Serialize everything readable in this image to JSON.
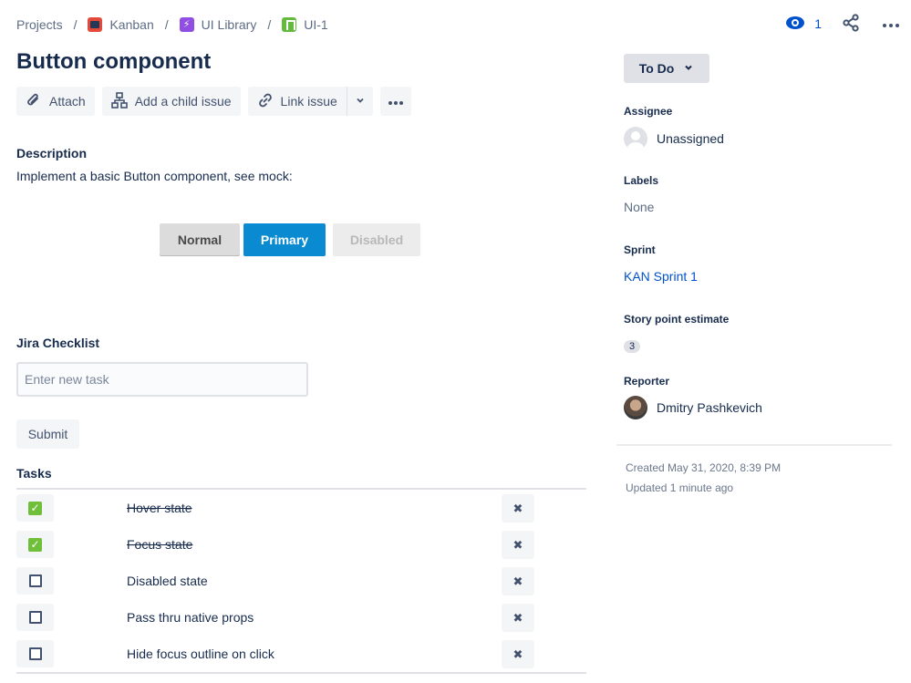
{
  "breadcrumb": {
    "projects": "Projects",
    "sep": "/",
    "kanban": "Kanban",
    "epic": "UI Library",
    "issue": "UI-1"
  },
  "header": {
    "watch_count": "1"
  },
  "issue": {
    "title": "Button component"
  },
  "actions": {
    "attach": "Attach",
    "add_child": "Add a child issue",
    "link_issue": "Link issue"
  },
  "description": {
    "heading": "Description",
    "text": "Implement a basic Button component, see mock:",
    "mock_buttons": {
      "normal": "Normal",
      "primary": "Primary",
      "disabled": "Disabled"
    }
  },
  "checklist": {
    "heading": "Jira Checklist",
    "placeholder": "Enter new task",
    "submit": "Submit",
    "tasks_heading": "Tasks",
    "tasks": [
      {
        "text": "Hover state",
        "done": true
      },
      {
        "text": "Focus state",
        "done": true
      },
      {
        "text": "Disabled state",
        "done": false
      },
      {
        "text": "Pass thru native props",
        "done": false
      },
      {
        "text": "Hide focus outline on click",
        "done": false
      }
    ],
    "delete_glyph": "✖"
  },
  "sidebar": {
    "status": "To Do",
    "assignee_label": "Assignee",
    "assignee": "Unassigned",
    "labels_label": "Labels",
    "labels": "None",
    "sprint_label": "Sprint",
    "sprint": "KAN Sprint 1",
    "story_points_label": "Story point estimate",
    "story_points": "3",
    "reporter_label": "Reporter",
    "reporter": "Dmitry Pashkevich",
    "created": "Created May 31, 2020, 8:39 PM",
    "updated": "Updated 1 minute ago"
  },
  "colors": {
    "link": "#0052cc",
    "primary_mock": "#0a8bd1",
    "done_check": "#6fbf3a"
  }
}
